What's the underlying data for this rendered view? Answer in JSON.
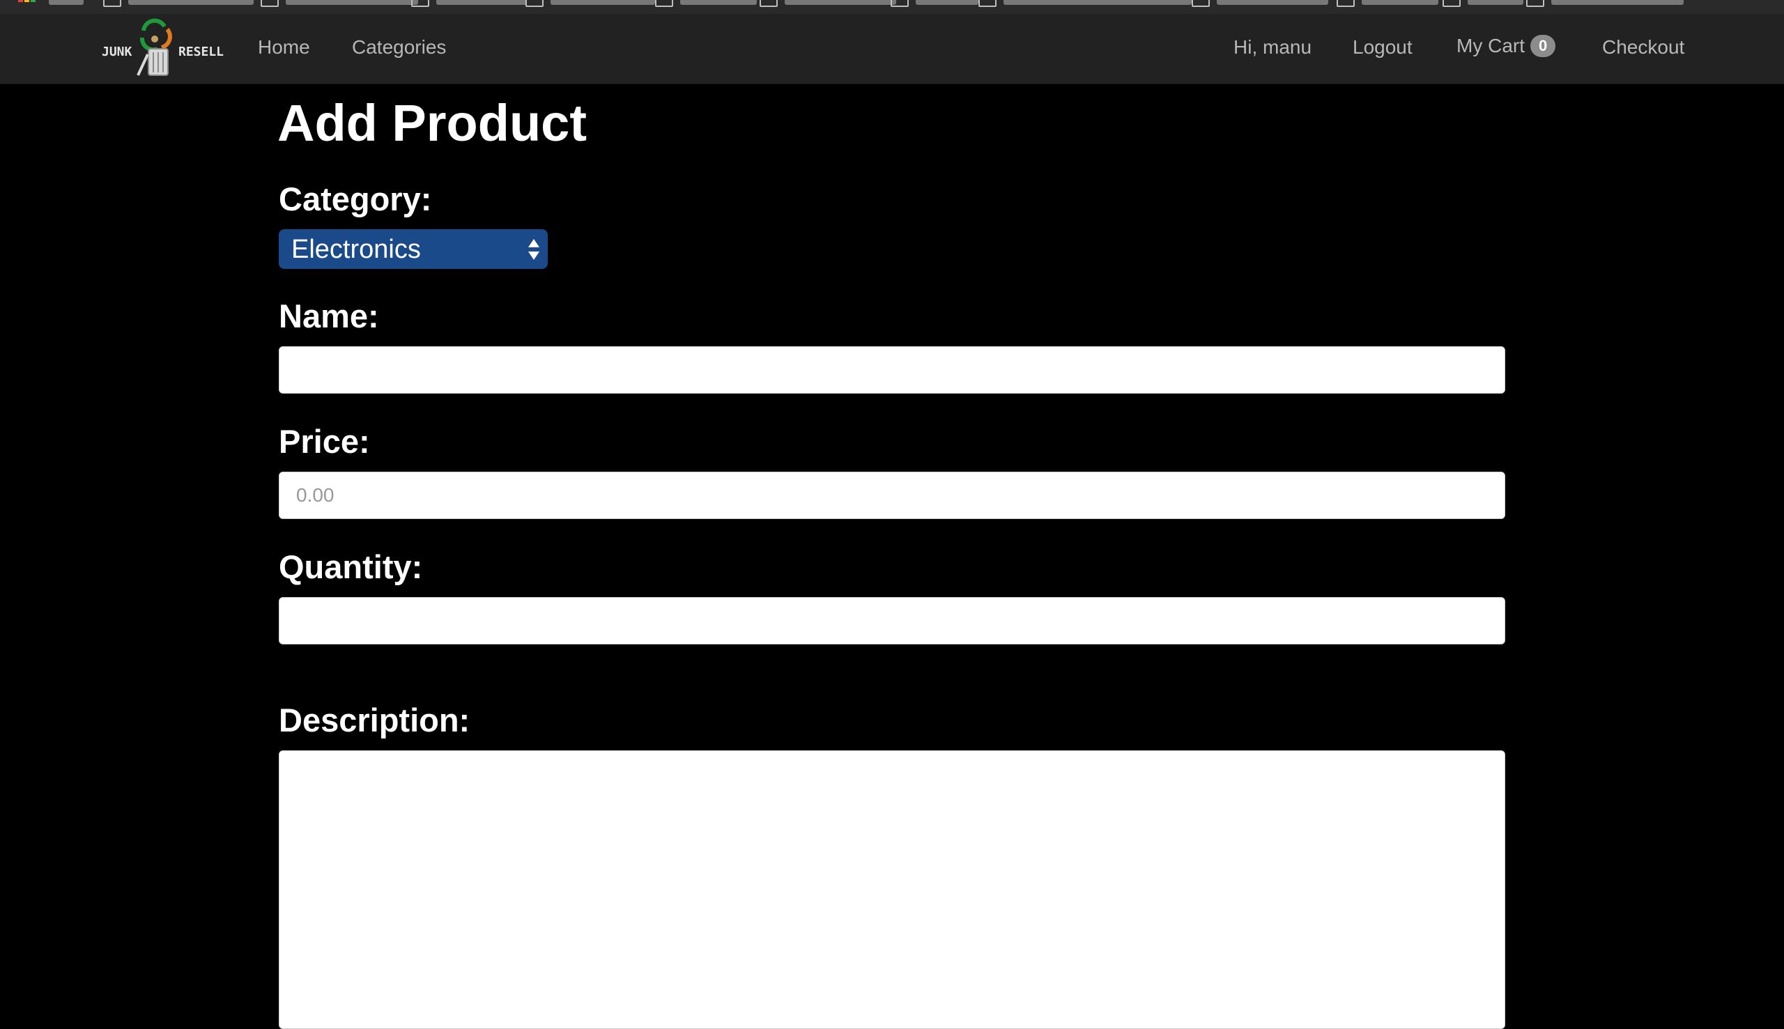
{
  "navbar": {
    "logo_text_left": "JUNK",
    "logo_text_right": "RESELL",
    "links": {
      "home": "Home",
      "categories": "Categories",
      "greeting": "Hi, manu",
      "logout": "Logout",
      "cart": "My Cart",
      "cart_count": "0",
      "checkout": "Checkout"
    }
  },
  "form": {
    "title": "Add Product",
    "category_label": "Category:",
    "category_selected": "Electronics",
    "name_label": "Name:",
    "name_value": "",
    "price_label": "Price:",
    "price_placeholder": "0.00",
    "quantity_label": "Quantity:",
    "quantity_value": "",
    "description_label": "Description:",
    "description_value": ""
  },
  "colors": {
    "page_background": "#000000",
    "navbar_background": "#222222",
    "select_background": "#1a4a8a",
    "badge_background": "#8c8c8c"
  },
  "icons": {
    "apps": "apps-grid-icon",
    "bookmark_folder": "bookmark-folder-icon",
    "select_arrows": "chevron-updown-icon",
    "logo": "recycle-trash-can-logo"
  }
}
